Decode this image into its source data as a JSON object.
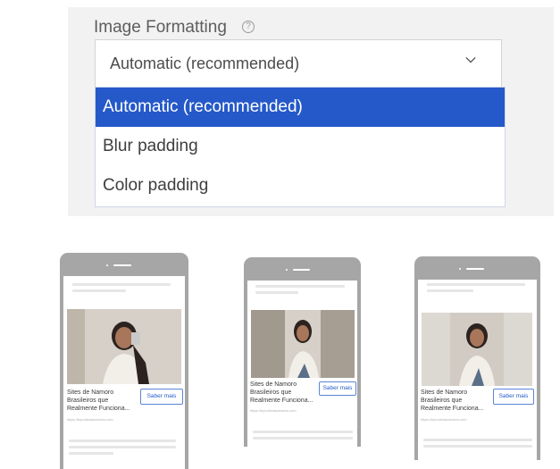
{
  "settings": {
    "field_label": "Image Formatting",
    "selected_value": "Automatic (recommended)",
    "options": [
      {
        "label": "Automatic (recommended)",
        "selected": true
      },
      {
        "label": "Blur padding",
        "selected": false
      },
      {
        "label": "Color padding",
        "selected": false
      }
    ],
    "help_icon": "question-circle-icon",
    "chevron_icon": "chevron-down-icon",
    "accent_color": "#2559c9"
  },
  "previews": [
    {
      "variant": "automatic",
      "ad_title": "Sites de Namoro Brasileiros que Realmente Funciona...",
      "cta_label": "Saber mais",
      "url": "https://bynoticiascenario.com"
    },
    {
      "variant": "blur-padding",
      "ad_title": "Sites de Namoro Brasileiros que Realmente Funciona...",
      "cta_label": "Saber mais",
      "url": "https://bynoticiascenario.com"
    },
    {
      "variant": "color-padding",
      "ad_title": "Sites de Namoro Brasileiros que Realmente Funciona...",
      "cta_label": "Saber mais",
      "url": "https://bynoticiascenario.com"
    }
  ]
}
